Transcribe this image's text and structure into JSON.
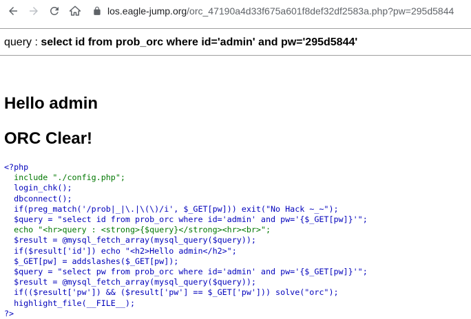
{
  "browser": {
    "url_host": "los.eagle-jump.org",
    "url_path": "/orc_47190a4d33f675a601f8def32df2583a.php?pw=295d5844"
  },
  "page": {
    "query_prefix": "query : ",
    "query_text": "select id from prob_orc where id='admin' and pw='295d5844'",
    "heading1": "Hello admin",
    "heading2": "ORC Clear!"
  },
  "source_code": {
    "open_tag": "<?php",
    "lines": [
      "  include \"./config.php\";",
      "  login_chk();",
      "  dbconnect();",
      "  if(preg_match('/prob|_|\\.|\\(\\)/i', $_GET[pw])) exit(\"No Hack ~_~\");",
      "  $query = \"select id from prob_orc where id='admin' and pw='{$_GET[pw]}'\";",
      "  echo \"<hr>query : <strong>{$query}</strong><hr><br>\";",
      "  $result = @mysql_fetch_array(mysql_query($query));",
      "  if($result['id']) echo \"<h2>Hello admin</h2>\";",
      "  $_GET[pw] = addslashes($_GET[pw]);",
      "  $query = \"select pw from prob_orc where id='admin' and pw='{$_GET[pw]}'\";",
      "  $result = @mysql_fetch_array(mysql_query($query));",
      "  if(($result['pw']) && ($result['pw'] == $_GET['pw'])) solve(\"orc\");",
      "  highlight_file(__FILE__);"
    ],
    "close_tag": "?>"
  },
  "colors": {
    "keyword": "#007700",
    "string": "#dd0000",
    "php_tag": "#0000bb"
  }
}
